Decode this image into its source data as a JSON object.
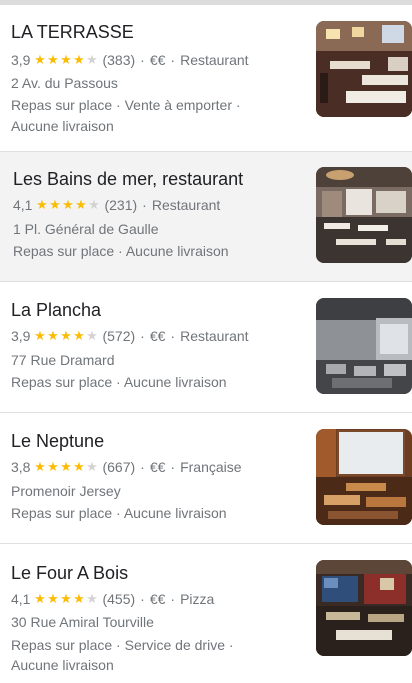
{
  "results": [
    {
      "name": "LA TERRASSE",
      "rating": "3,9",
      "stars": 4,
      "reviews": "(383)",
      "price": "€€",
      "category": "Restaurant",
      "address": "2 Av. du Passous",
      "services_line1": "Repas sur place · Vente à emporter ·",
      "services_line2": "Aucune livraison",
      "image": "restaurant-terrace-photo"
    },
    {
      "name": "Les Bains de mer, restaurant",
      "rating": "4,1",
      "stars": 4,
      "reviews": "(231)",
      "price": "",
      "category": "Restaurant",
      "address": "1 Pl. Général de Gaulle",
      "services_line1": "Repas sur place · Aucune livraison",
      "services_line2": "",
      "image": "dining-room-photo"
    },
    {
      "name": "La Plancha",
      "rating": "3,9",
      "stars": 4,
      "reviews": "(572)",
      "price": "€€",
      "category": "Restaurant",
      "address": "77 Rue Dramard",
      "services_line1": "Repas sur place · Aucune livraison",
      "services_line2": "",
      "image": "interior-photo"
    },
    {
      "name": "Le Neptune",
      "rating": "3,8",
      "stars": 4,
      "reviews": "(667)",
      "price": "€€",
      "category": "Française",
      "address": "Promenoir Jersey",
      "services_line1": "Repas sur place · Aucune livraison",
      "services_line2": "",
      "image": "bar-interior-photo"
    },
    {
      "name": "Le Four A Bois",
      "rating": "4,1",
      "stars": 4,
      "reviews": "(455)",
      "price": "€€",
      "category": "Pizza",
      "address": "30 Rue Amiral Tourville",
      "services_line1": "Repas sur place · Service de drive ·",
      "services_line2": "Aucune livraison",
      "image": "pizzeria-interior-photo"
    }
  ],
  "separator": "·",
  "colors": {
    "star": "#fbbc04",
    "star_empty": "#d3d3d3",
    "text_secondary": "#70757a",
    "title": "#202124"
  }
}
